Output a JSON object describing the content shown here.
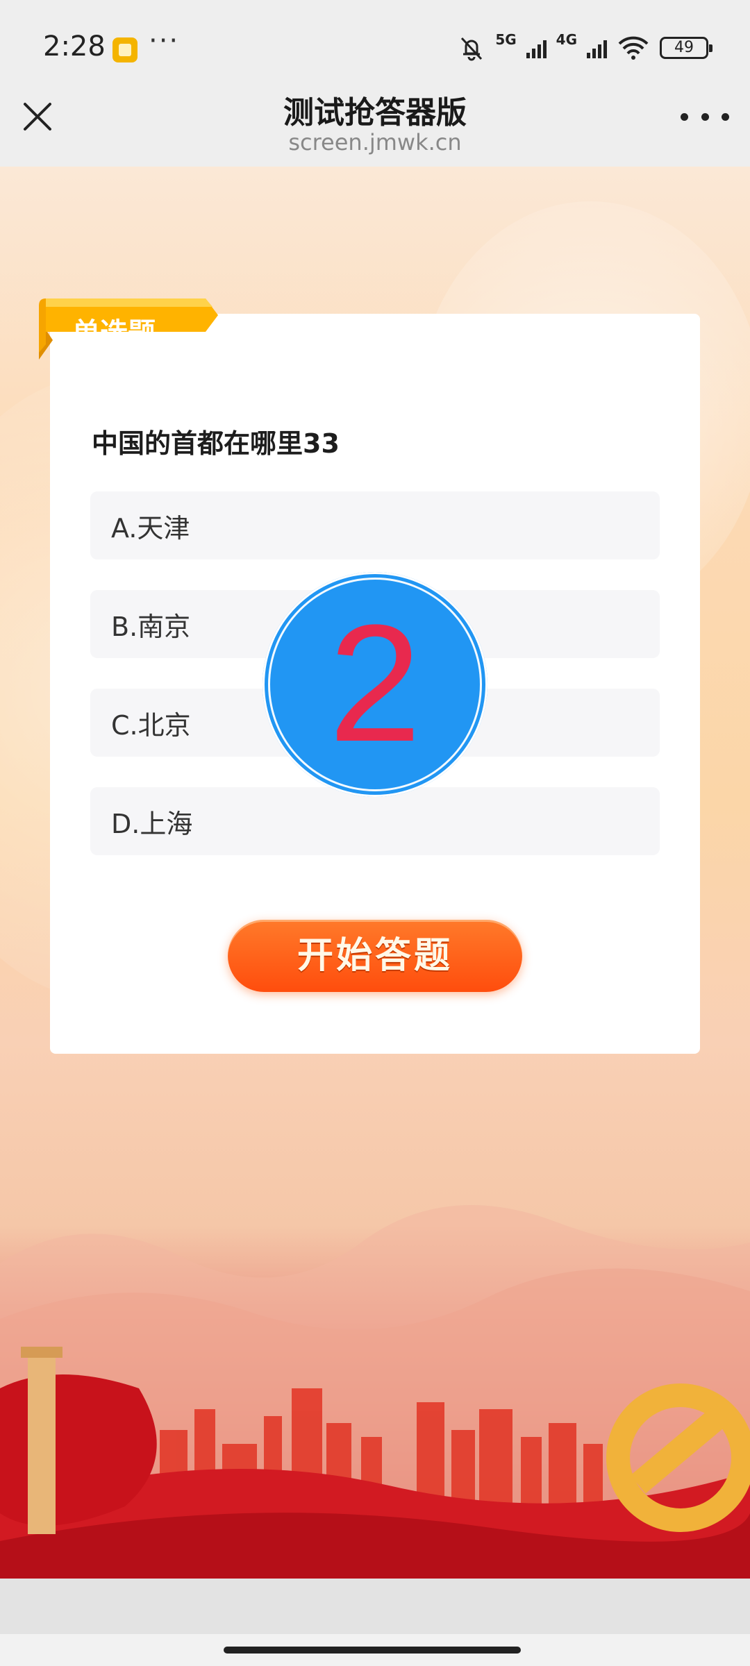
{
  "status_bar": {
    "time": "2:28",
    "more_dots": "···",
    "net1": "5G",
    "net2": "4G",
    "battery": "49"
  },
  "header": {
    "title": "测试抢答器版",
    "url": "screen.jmwk.cn"
  },
  "quiz": {
    "type_tag": "单选题",
    "question": "中国的首都在哪里33",
    "options": [
      {
        "label": "A.天津"
      },
      {
        "label": "B.南京"
      },
      {
        "label": "C.北京"
      },
      {
        "label": "D.上海"
      }
    ],
    "countdown": "2",
    "start_button": "开始答题"
  },
  "colors": {
    "countdown_bg": "#2196f3",
    "countdown_digit": "#e8294e",
    "start_button": "#ff5a14",
    "tag": "#ffb300"
  }
}
